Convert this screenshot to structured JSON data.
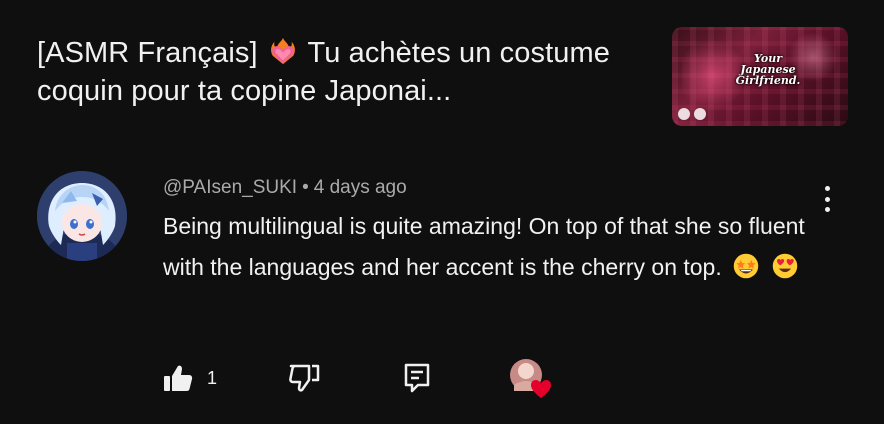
{
  "video": {
    "title_before": "[ASMR Français]",
    "title_after": "Tu achètes un costume coquin pour ta copine Japonai...",
    "title_emoji": "heart-on-fire-emoji",
    "thumbnail_caption": "Your Japanese Girlfriend."
  },
  "comment": {
    "author": "@PAIsen_SUKI",
    "separator": "•",
    "time": "4 days ago",
    "text": "Being multilingual is quite amazing! On top of that she so fluent with the languages and her accent is the cherry on top.",
    "emojis": [
      "star-struck-emoji",
      "heart-eyes-emoji"
    ],
    "like_count": "1",
    "creator_heart": true
  },
  "icons": {
    "like": "thumbs-up-filled-icon",
    "dislike": "thumbs-down-outline-icon",
    "reply": "reply-comment-icon",
    "more": "vertical-dots-icon"
  },
  "colors": {
    "background": "#0f0f0f",
    "text": "#f1f1f1",
    "secondary_text": "#aaaaaa",
    "heart": "#e4002b"
  }
}
